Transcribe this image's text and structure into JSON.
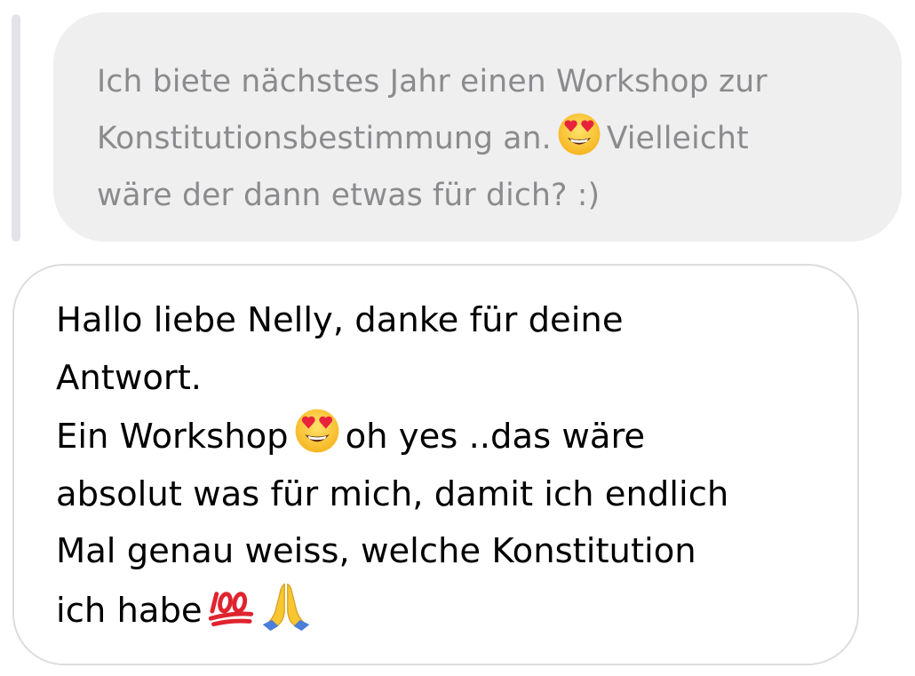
{
  "quoted_message": {
    "line1": "Ich biete nächstes Jahr einen Workshop zur",
    "line2_before": "Konstitutionsbestimmung an.",
    "line2_after": "Vielleicht",
    "line3": "wäre der dann etwas für dich? :)",
    "emoji": "smiling-face-with-heart-eyes"
  },
  "reply_message": {
    "para1": "Hallo liebe Nelly, danke für deine\nAntwort.",
    "para2_before": "Ein Workshop",
    "para2_after": "oh yes ..das wäre",
    "para2_rest": "absolut was für mich, damit ich endlich\nMal genau weiss, welche Konstitution\nich habe",
    "emojis": [
      "smiling-face-with-heart-eyes",
      "hundred-points",
      "folded-hands"
    ]
  },
  "colors": {
    "quoted_bubble_bg": "#efeff0",
    "quoted_text": "#8b8b8d",
    "reply_border": "#dcdcde",
    "reply_text": "#000000",
    "quote_bar": "#e4e4e6"
  }
}
